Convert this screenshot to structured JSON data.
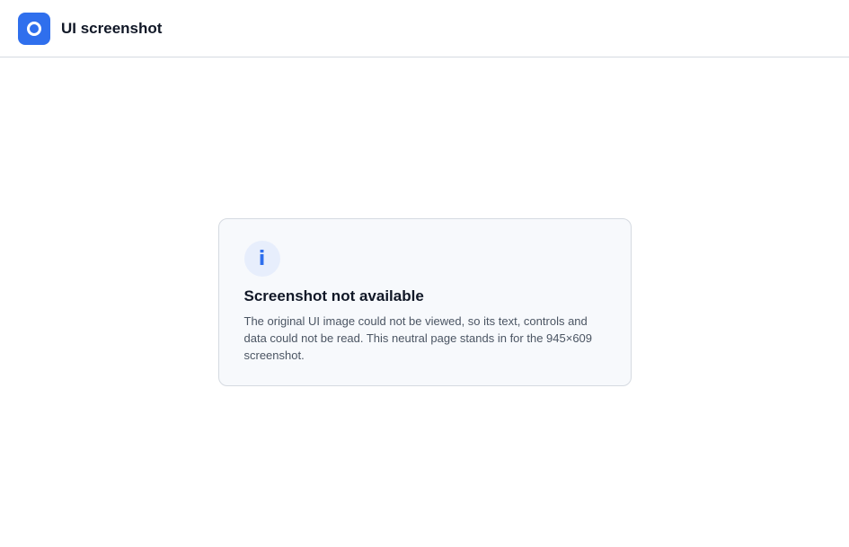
{
  "header": {
    "title": "UI screenshot"
  },
  "notice": {
    "icon": "info-icon",
    "title": "Screenshot not available",
    "message": "The original UI image could not be viewed, so its text, controls and data could not be read. This neutral page stands in for the 945×609 screenshot."
  }
}
